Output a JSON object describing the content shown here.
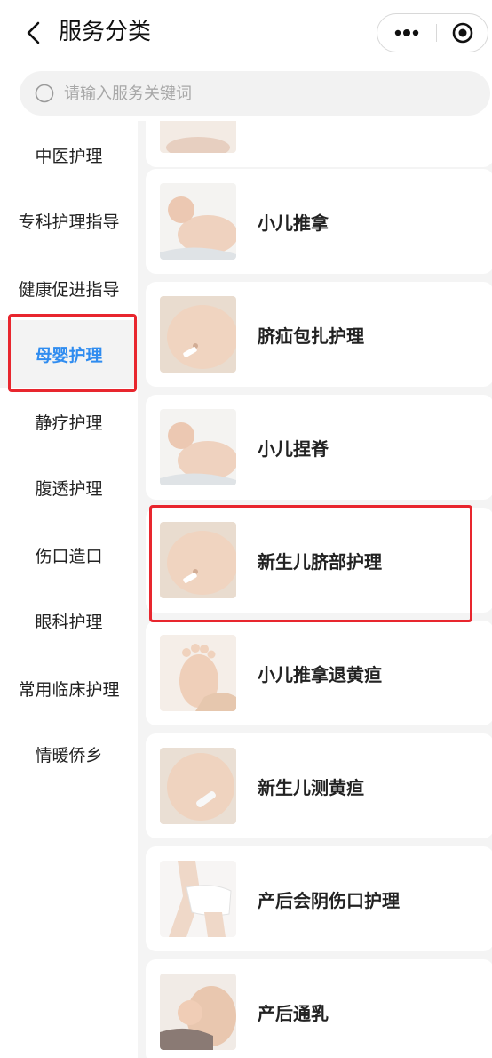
{
  "header": {
    "title": "服务分类"
  },
  "search": {
    "placeholder": "请输入服务关键词"
  },
  "sidebar": {
    "active_color": "#2f8cf0",
    "items": [
      {
        "label": "中医护理"
      },
      {
        "label": "专科护理指导"
      },
      {
        "label": "健康促进指导"
      },
      {
        "label": "母婴护理",
        "active": true
      },
      {
        "label": "静疗护理"
      },
      {
        "label": "腹透护理"
      },
      {
        "label": "伤口造口"
      },
      {
        "label": "眼科护理"
      },
      {
        "label": "常用临床护理"
      },
      {
        "label": "情暖侨乡"
      }
    ]
  },
  "services": [
    {
      "label": "小儿推拿",
      "image": "baby-back-photo"
    },
    {
      "label": "脐疝包扎护理",
      "image": "baby-belly-photo"
    },
    {
      "label": "小儿捏脊",
      "image": "baby-back-photo"
    },
    {
      "label": "新生儿脐部护理",
      "image": "baby-belly-photo"
    },
    {
      "label": "小儿推拿退黄疸",
      "image": "baby-foot-photo"
    },
    {
      "label": "新生儿测黄疸",
      "image": "baby-belly-photo"
    },
    {
      "label": "产后会阴伤口护理",
      "image": "postpartum-photo"
    },
    {
      "label": "产后通乳",
      "image": "breastfeeding-photo"
    }
  ],
  "highlight_color": "#e8262e"
}
